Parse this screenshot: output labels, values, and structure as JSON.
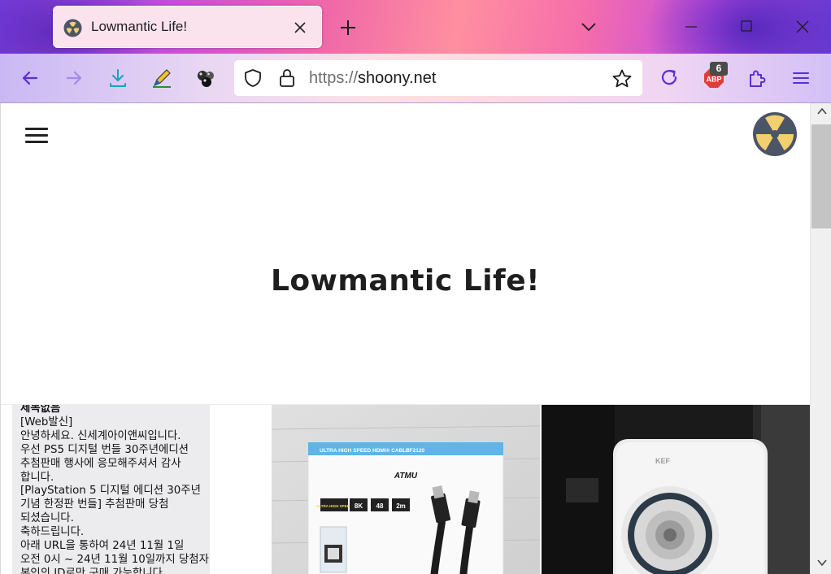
{
  "browser": {
    "tab": {
      "title": "Lowmantic Life!",
      "favicon": "radiation-icon"
    },
    "url": {
      "scheme": "https://",
      "host": "shoony.net"
    },
    "extensions": {
      "adblock_badge": "6"
    },
    "icons": [
      "back-icon",
      "forward-icon",
      "download-icon",
      "pen-icon",
      "balls-extension-icon",
      "shield-icon",
      "lock-icon",
      "star-icon",
      "reload-icon",
      "adblock-icon",
      "extensions-icon",
      "menu-icon"
    ],
    "colors": {
      "accent": "#5b2fd6"
    }
  },
  "page": {
    "title": "Lowmantic Life!",
    "post_text": {
      "title": "제목없음",
      "lines": [
        "[Web발신]",
        "안녕하세요. 신세계아이앤씨입니다.",
        "우선 PS5 디지털 번들 30주년에디션",
        "추첨판매 행사에 응모해주셔서 감사",
        "합니다.",
        "[PlayStation 5 디지털 에디션 30주년",
        "기념 한정판 번들] 추첨판매 당첨",
        "되셨습니다.",
        "축하드립니다.",
        "아래 URL을 통하여 24년 11월 1일",
        "오전 0시 ~ 24년 11월 10일까지 당첨자",
        "본인의 ID로만 구매 가능합니다."
      ]
    },
    "hdmi_box": {
      "header": "ULTRA HIGH SPEED HDMI® CABLE",
      "code": "HF2120",
      "brand": "ATMU",
      "badges": [
        "ULTRA HIGH SPEED",
        "8K",
        "48",
        "2m"
      ]
    },
    "kef_photo": {
      "brand": "KEF"
    }
  }
}
